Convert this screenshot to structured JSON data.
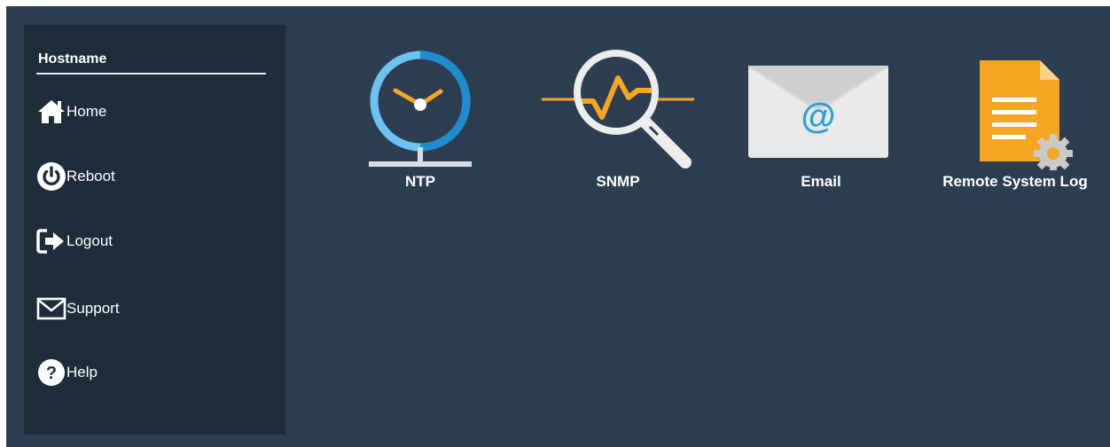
{
  "sidebar": {
    "title": "Hostname",
    "items": [
      {
        "label": "Home",
        "icon": "home-icon"
      },
      {
        "label": "Reboot",
        "icon": "power-icon"
      },
      {
        "label": "Logout",
        "icon": "logout-icon"
      },
      {
        "label": "Support",
        "icon": "envelope-icon"
      },
      {
        "label": "Help",
        "icon": "help-icon"
      }
    ]
  },
  "main": {
    "tiles": [
      {
        "label": "NTP",
        "icon": "clock-icon"
      },
      {
        "label": "SNMP",
        "icon": "magnifier-signal-icon"
      },
      {
        "label": "Email",
        "icon": "email-envelope-icon"
      },
      {
        "label": "Remote System Log",
        "icon": "document-gear-icon"
      }
    ]
  },
  "colors": {
    "background": "#2d3e51",
    "sidebar": "#1f2c3a",
    "accent_blue": "#2a9fd8",
    "accent_orange": "#f5a623"
  }
}
